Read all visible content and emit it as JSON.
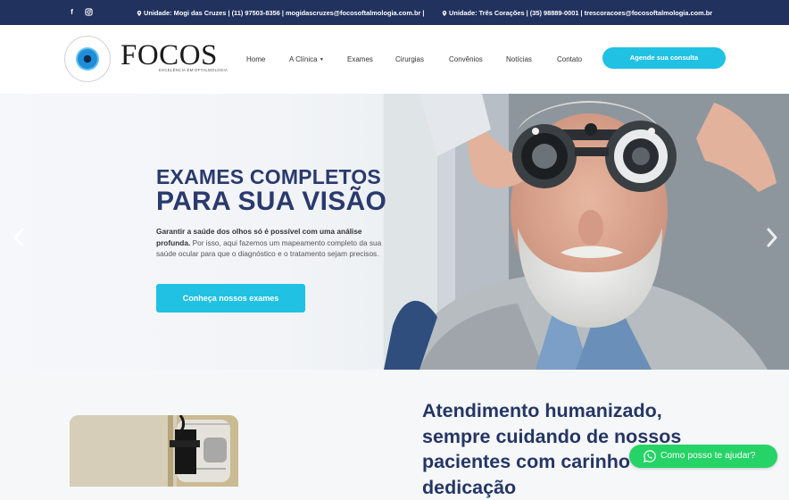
{
  "topbar": {
    "unit1": "Unidade: Mogi das Cruzes | (11) 97503-8356 | mogidascruzes@focosoftalmologia.com.br |",
    "unit2": "Unidade: Três Corações | (35) 98889-0001 | trescoracoes@focosoftalmologia.com.br",
    "social": [
      "facebook-icon",
      "instagram-icon"
    ]
  },
  "brand": {
    "name": "FOCOS",
    "tagline": "EXCELÊNCIA EM OFTALMOLOGIA"
  },
  "nav": {
    "items": [
      "Home",
      "A Clínica",
      "Exames",
      "Cirurgias",
      "Convênios",
      "Notícias",
      "Contato"
    ],
    "cta": "Agende sua consulta"
  },
  "hero": {
    "title_line1": "EXAMES COMPLETOS",
    "title_line2": "PARA SUA VISÃO",
    "text_bold": "Garantir a saúde dos olhos só é possível com uma análise profunda.",
    "text_rest": " Por isso, aqui fazemos um mapeamento completo da sua saúde ocular para que o diagnóstico e o tratamento sejam precisos.",
    "button": "Conheça nossos exames"
  },
  "section": {
    "title": "Atendimento humanizado, sempre cuidando de nossos pacientes com carinho e dedicação"
  },
  "whatsapp": {
    "label": "Como posso te ajudar?"
  },
  "colors": {
    "navy": "#21325e",
    "accent": "#20c1e3",
    "title": "#2a3a6d",
    "whatsapp": "#25d366"
  }
}
